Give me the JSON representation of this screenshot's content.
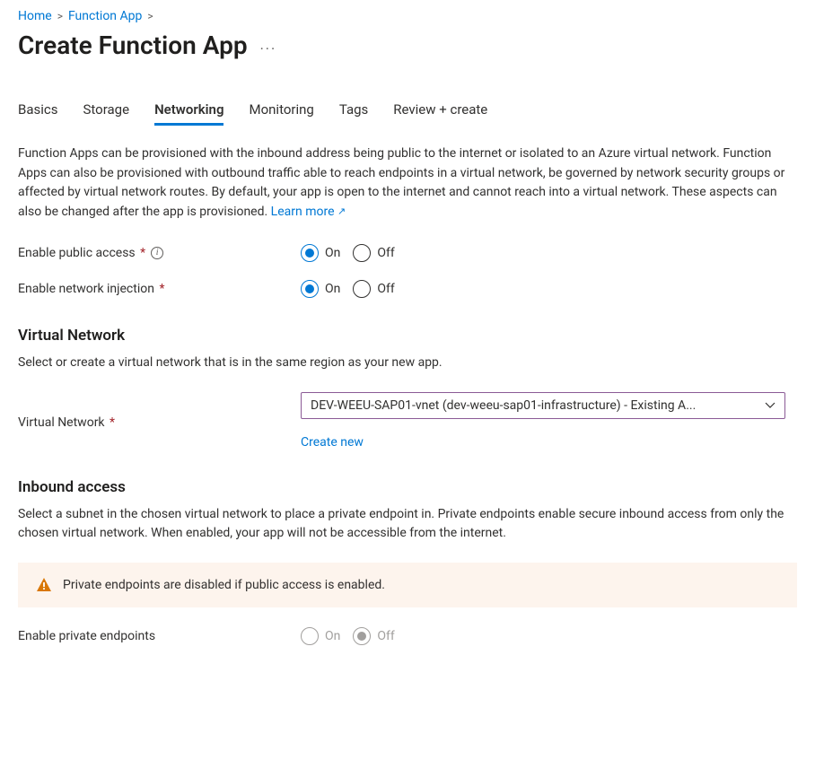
{
  "breadcrumb": {
    "home": "Home",
    "functionApp": "Function App"
  },
  "pageTitle": "Create Function App",
  "tabs": {
    "basics": "Basics",
    "storage": "Storage",
    "networking": "Networking",
    "monitoring": "Monitoring",
    "tags": "Tags",
    "review": "Review + create"
  },
  "desc": {
    "main": "Function Apps can be provisioned with the inbound address being public to the internet or isolated to an Azure virtual network. Function Apps can also be provisioned with outbound traffic able to reach endpoints in a virtual network, be governed by network security groups or affected by virtual network routes. By default, your app is open to the internet and cannot reach into a virtual network. These aspects can also be changed after the app is provisioned.  ",
    "learnMore": "Learn more"
  },
  "labels": {
    "enablePublicAccess": "Enable public access",
    "enableNetworkInjection": "Enable network injection",
    "on": "On",
    "off": "Off",
    "virtualNetwork": "Virtual Network",
    "createNew": "Create new",
    "enablePrivateEndpoints": "Enable private endpoints"
  },
  "sections": {
    "vnTitle": "Virtual Network",
    "vnDesc": "Select or create a virtual network that is in the same region as your new app.",
    "inboundTitle": "Inbound access",
    "inboundDesc": "Select a subnet in the chosen virtual network to place a private endpoint in. Private endpoints enable secure inbound access from only the chosen virtual network. When enabled, your app will not be accessible from the internet."
  },
  "vn": {
    "selected": "DEV-WEEU-SAP01-vnet (dev-weeu-sap01-infrastructure) - Existing A..."
  },
  "warning": {
    "text": "Private endpoints are disabled if public access is enabled."
  }
}
